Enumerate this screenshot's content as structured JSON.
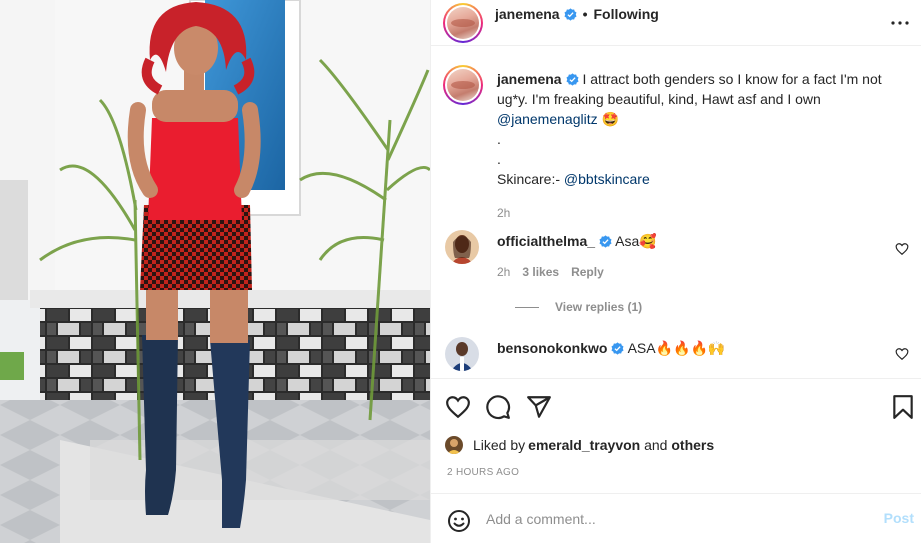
{
  "header": {
    "username": "janemena",
    "separator": "•",
    "follow_status": "Following",
    "more_icon": "more-horizontal-icon"
  },
  "caption": {
    "username": "janemena",
    "text_part1": " I attract both genders so I know for a fact I'm not ug*y. I'm freaking beautiful, kind, Hawt asf and I own ",
    "mention1": "@janemenaglitz",
    "emoji1": "🤩",
    "line_dot1": ".",
    "line_dot2": ".",
    "skincare_label": "Skincare:- ",
    "mention2": "@bbtskincare",
    "time": "2h"
  },
  "comments": [
    {
      "username": "officialthelma_",
      "text": "Asa🥰",
      "time": "2h",
      "likes": "3 likes",
      "reply": "Reply"
    },
    {
      "username": "bensonokonkwo",
      "text": "ASA🔥🔥🔥🙌",
      "time": "",
      "likes": "",
      "reply": ""
    }
  ],
  "view_replies": "View replies (1)",
  "actions": {
    "like_icon": "heart-icon",
    "comment_icon": "comment-icon",
    "share_icon": "share-icon",
    "save_icon": "bookmark-icon"
  },
  "likes_line": {
    "prefix": "Liked by ",
    "user": "emerald_trayvon",
    "middle": " and ",
    "suffix": "others"
  },
  "time_ago": "2 HOURS AGO",
  "add_comment": {
    "placeholder": "Add a comment...",
    "post_label": "Post",
    "emoji_icon": "smiley-icon"
  },
  "colors": {
    "verified": "#3897f0",
    "link": "#00376b",
    "muted": "#8e8e8e",
    "post_disabled": "#b2dffc"
  }
}
